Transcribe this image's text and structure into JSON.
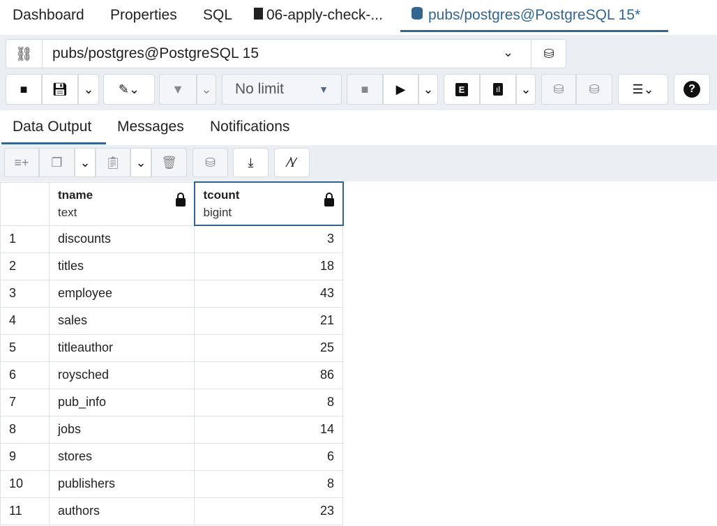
{
  "tabs": [
    {
      "label": "Dashboard"
    },
    {
      "label": "Properties"
    },
    {
      "label": "SQL"
    },
    {
      "label": "06-apply-check-..."
    },
    {
      "label": "pubs/postgres@PostgreSQL 15*",
      "active": true
    }
  ],
  "connection": {
    "value": "pubs/postgres@PostgreSQL 15"
  },
  "toolbar": {
    "limit": "No limit"
  },
  "result_tabs": [
    {
      "label": "Data Output",
      "active": true
    },
    {
      "label": "Messages"
    },
    {
      "label": "Notifications"
    }
  ],
  "grid": {
    "columns": [
      {
        "name": "tname",
        "type": "text"
      },
      {
        "name": "tcount",
        "type": "bigint"
      }
    ],
    "rows": [
      {
        "n": "1",
        "tname": "discounts",
        "tcount": "3"
      },
      {
        "n": "2",
        "tname": "titles",
        "tcount": "18"
      },
      {
        "n": "3",
        "tname": "employee",
        "tcount": "43"
      },
      {
        "n": "4",
        "tname": "sales",
        "tcount": "21"
      },
      {
        "n": "5",
        "tname": "titleauthor",
        "tcount": "25"
      },
      {
        "n": "6",
        "tname": "roysched",
        "tcount": "86"
      },
      {
        "n": "7",
        "tname": "pub_info",
        "tcount": "8"
      },
      {
        "n": "8",
        "tname": "jobs",
        "tcount": "14"
      },
      {
        "n": "9",
        "tname": "stores",
        "tcount": "6"
      },
      {
        "n": "10",
        "tname": "publishers",
        "tcount": "8"
      },
      {
        "n": "11",
        "tname": "authors",
        "tcount": "23"
      }
    ]
  },
  "colors": {
    "accent": "#326690",
    "toolbar_bg": "#ebeef3"
  }
}
